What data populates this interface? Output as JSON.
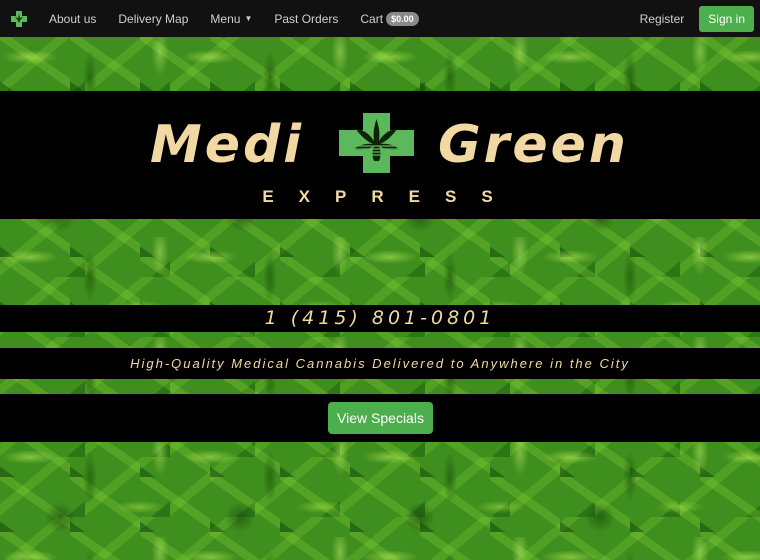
{
  "nav": {
    "brand_icon": "cannabis-cross-icon",
    "items": [
      {
        "label": "About us"
      },
      {
        "label": "Delivery Map"
      },
      {
        "label": "Menu"
      },
      {
        "label": "Past Orders"
      }
    ],
    "cart_label": "Cart",
    "cart_total": "$0.00",
    "register_label": "Register",
    "signin_label": "Sign in"
  },
  "hero": {
    "logo_left": "Medi",
    "logo_right": "Green",
    "logo_sub": "EXPRESS",
    "phone": "1 (415) 801-0801",
    "tagline": "High-Quality Medical Cannabis Delivered to Anywhere in the City",
    "cta_label": "View Specials"
  },
  "colors": {
    "accent": "#4cae4c",
    "logo_text": "#f2d9a3",
    "navbar": "#111111"
  }
}
